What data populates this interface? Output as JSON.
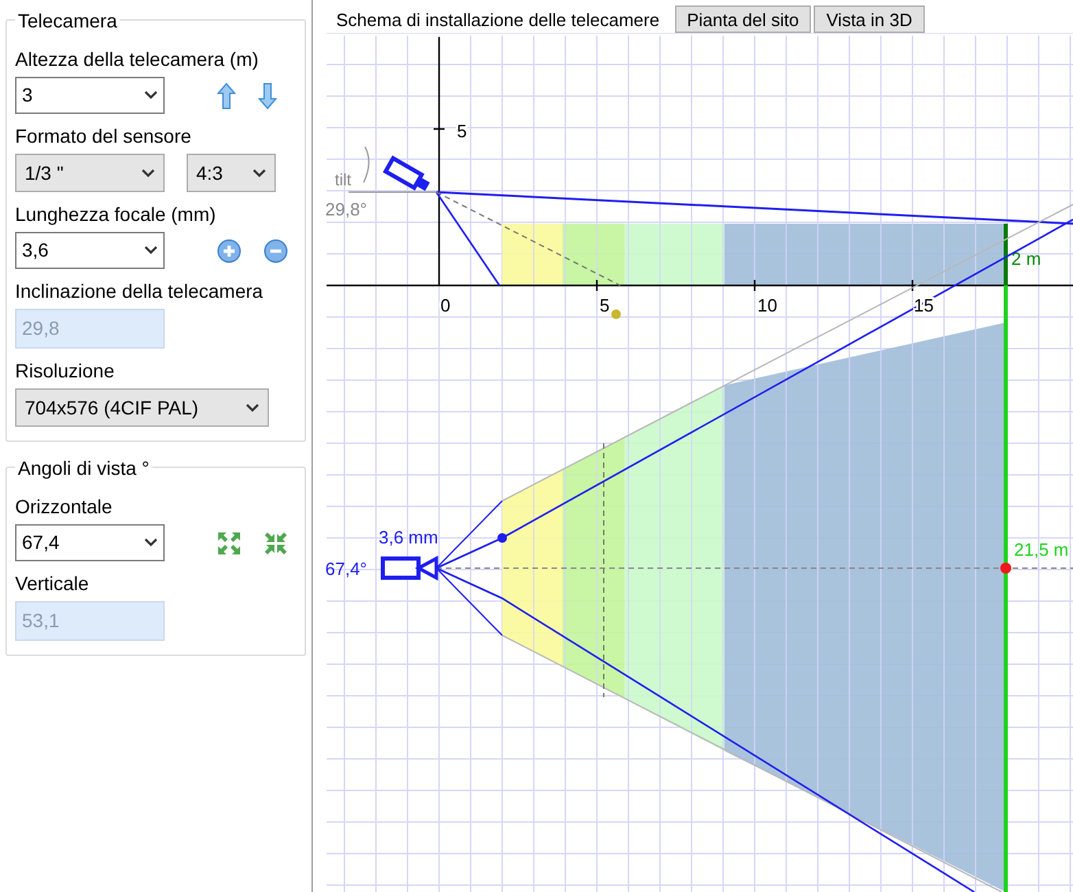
{
  "panel": {
    "groups": [
      {
        "title": "Telecamera",
        "fields": [
          {
            "label": "Altezza della telecamera (m)",
            "controls": [
              {
                "kind": "combo",
                "value": "3"
              }
            ],
            "actions": [
              {
                "kind": "up"
              },
              {
                "kind": "down"
              }
            ]
          },
          {
            "label": "Formato del sensore",
            "controls": [
              {
                "kind": "dropdown",
                "value": "1/3 \""
              },
              {
                "kind": "dropdown",
                "value": "4:3"
              }
            ]
          },
          {
            "label": "Lunghezza focale (mm)",
            "controls": [
              {
                "kind": "combo",
                "value": "3,6"
              }
            ],
            "actions": [
              {
                "kind": "plus"
              },
              {
                "kind": "minus"
              }
            ]
          },
          {
            "label": "Inclinazione della telecamera",
            "controls": [
              {
                "kind": "readonly",
                "value": "29,8"
              }
            ]
          },
          {
            "label": "Risoluzione",
            "controls": [
              {
                "kind": "dropdown",
                "value": "704x576 (4CIF PAL)"
              }
            ]
          }
        ]
      },
      {
        "title": "Angoli di vista °",
        "fields": [
          {
            "label": "Orizzontale",
            "controls": [
              {
                "kind": "combo",
                "value": "67,4"
              }
            ],
            "actions": [
              {
                "kind": "expand"
              },
              {
                "kind": "shrink"
              }
            ]
          },
          {
            "label": "Verticale",
            "controls": [
              {
                "kind": "readonly",
                "value": "53,1"
              }
            ]
          }
        ]
      }
    ]
  },
  "tabs": [
    {
      "label": "Schema di installazione delle telecamere",
      "selected": true
    },
    {
      "label": "Pianta del sito",
      "selected": false
    },
    {
      "label": "Vista in 3D",
      "selected": false
    }
  ],
  "diagram": {
    "side_view": {
      "axis_labels": [
        "5",
        "0",
        "5",
        "10",
        "15"
      ],
      "tilt_label": "tilt",
      "tilt_angle": "29,8°",
      "height_label": "2 m"
    },
    "top_view": {
      "focal_label": "3,6 mm",
      "angle_label": "67,4°",
      "distance_label": "21,5 m"
    }
  }
}
